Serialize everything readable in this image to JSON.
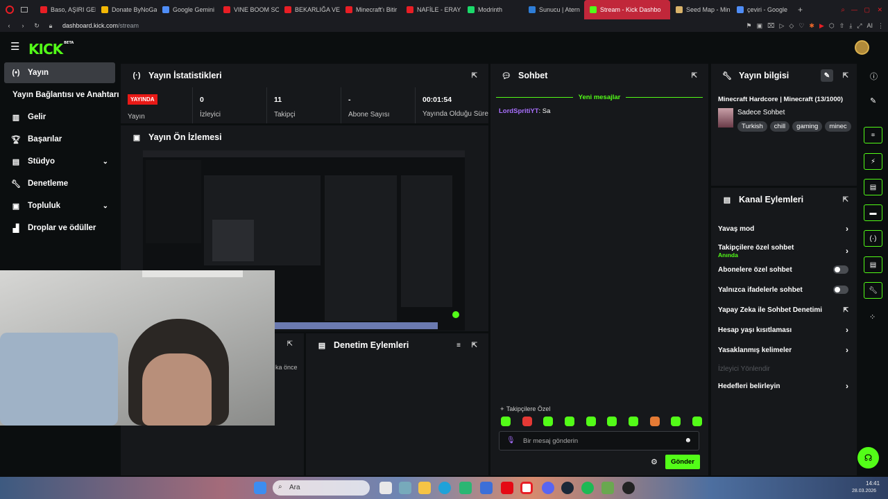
{
  "browser": {
    "tabs": [
      {
        "label": "Baso, AŞIRI GER",
        "color": "#e81e25"
      },
      {
        "label": "Donate ByNoGa",
        "color": "#f2b705"
      },
      {
        "label": "Google Gemini",
        "color": "#4f8df6"
      },
      {
        "label": "VINE BOOM SO",
        "color": "#e81e25"
      },
      {
        "label": "BEKARLIĞA VE",
        "color": "#e81e25"
      },
      {
        "label": "Minecraft'ı Bitir",
        "color": "#e81e25"
      },
      {
        "label": "NAFİLE - ERAY",
        "color": "#e81e25"
      },
      {
        "label": "Modrinth",
        "color": "#1bd96a"
      },
      {
        "label": "Sunucu | Atern",
        "color": "#2e7dd7"
      },
      {
        "label": "Stream - Kick Dashbo",
        "color": "#53fc18",
        "active": true
      },
      {
        "label": "Seed Map - Min",
        "color": "#d9b36a"
      },
      {
        "label": "çeviri - Google",
        "color": "#4f8df6"
      }
    ],
    "new_tab": "+",
    "url_host": "dashboard.kick.com",
    "url_path": "/stream",
    "toolbar_ai": "AI"
  },
  "header": {
    "logo": "KICK",
    "logo_sup": "BETA"
  },
  "sidebar": {
    "items": [
      {
        "label": "Yayın",
        "icon": "broadcast-icon",
        "glyph": "(•)",
        "active": true
      },
      {
        "label": "Yayın Bağlantısı ve Anahtarı",
        "icon": "",
        "glyph": ""
      },
      {
        "label": "Gelir",
        "icon": "chart-icon",
        "glyph": "▥"
      },
      {
        "label": "Başarılar",
        "icon": "trophy-icon",
        "glyph": "🏆︎"
      },
      {
        "label": "Stüdyo",
        "icon": "studio-icon",
        "glyph": "▤",
        "chevron": true
      },
      {
        "label": "Denetleme",
        "icon": "wrench-icon",
        "glyph": "🔧︎"
      },
      {
        "label": "Topluluk",
        "icon": "community-icon",
        "glyph": "▣",
        "chevron": true
      },
      {
        "label": "Droplar ve ödüller",
        "icon": "drops-icon",
        "glyph": "▟"
      }
    ]
  },
  "stats": {
    "title": "Yayın İstatistikleri",
    "live_badge": "YAYINDA",
    "live_label": "Yayın",
    "items": [
      {
        "value": "0",
        "label": "İzleyici"
      },
      {
        "value": "11",
        "label": "Takipçi"
      },
      {
        "value": "-",
        "label": "Abone Sayısı"
      },
      {
        "value": "00:01:54",
        "label": "Yayında Olduğu Süre"
      }
    ]
  },
  "preview": {
    "title": "Yayın Ön İzlemesi"
  },
  "mod_actions": {
    "title": "Denetim Eylemleri"
  },
  "hidden_panel": {
    "partial_text": "ka önce"
  },
  "chat": {
    "title": "Sohbet",
    "divider": "Yeni mesajlar",
    "messages": [
      {
        "user": "LordSpritiYT",
        "text": ": Sa"
      }
    ],
    "followers_only": "Takipçilere Özel",
    "placeholder": "Bir mesaj gönderin",
    "send": "Gönder"
  },
  "stream_info": {
    "title": "Yayın bilgisi",
    "stream_title": "Minecraft Hardcore | Minecraft (13/1000)",
    "category": "Sadece Sohbet",
    "tags": [
      "Turkish",
      "chill",
      "gaming",
      "minec"
    ]
  },
  "channel_actions": {
    "title": "Kanal Eylemleri",
    "rows": [
      {
        "label": "Yavaş mod",
        "control": "arrow"
      },
      {
        "label": "Takipçilere özel sohbet",
        "sub": "Anında",
        "control": "arrow"
      },
      {
        "label": "Abonelere özel sohbet",
        "control": "toggle"
      },
      {
        "label": "Yalnızca ifadelerle sohbet",
        "control": "toggle"
      },
      {
        "label": "Yapay Zeka ile Sohbet Denetimi",
        "control": "external"
      },
      {
        "label": "Hesap yaşı kısıtlaması",
        "control": "arrow"
      },
      {
        "label": "Yasaklanmış kelimeler",
        "control": "arrow"
      },
      {
        "label": "İzleyici Yönlendir",
        "control": "none",
        "disabled": true
      },
      {
        "label": "Hedefleri belirleyin",
        "control": "arrow"
      }
    ]
  },
  "taskbar": {
    "search": "Ara",
    "time": "14:41",
    "date": "28.03.2026"
  },
  "colors": {
    "accent": "#53fc18",
    "live": "#e91916",
    "panel": "#16181b",
    "bg": "#0b0e0f",
    "username": "#a970ff"
  }
}
